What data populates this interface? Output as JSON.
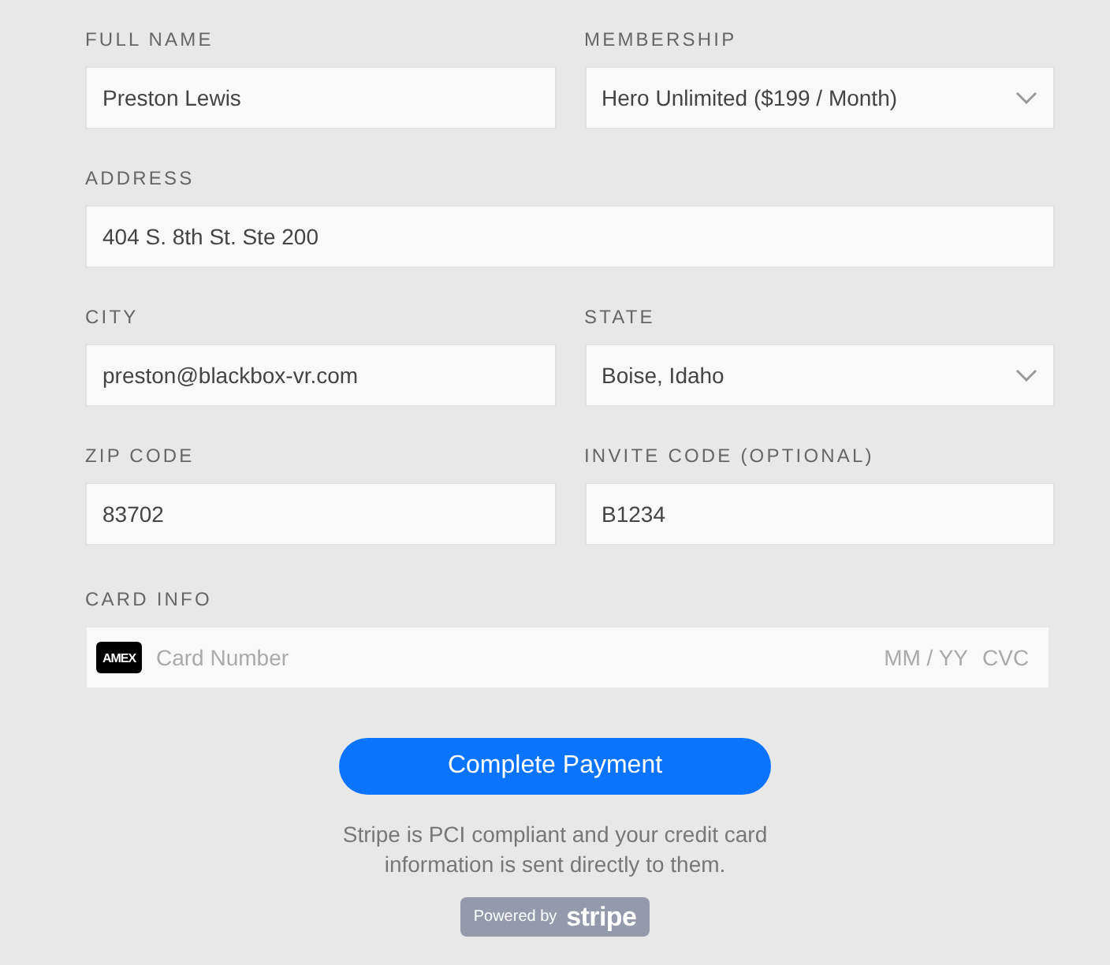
{
  "rows": [
    {
      "fields": [
        {
          "label": "FULL NAME",
          "kind": "text",
          "value": "Preston Lewis"
        },
        {
          "label": "MEMBERSHIP",
          "kind": "select",
          "value": "Hero Unlimited ($199 / Month)"
        }
      ]
    },
    {
      "fields": [
        {
          "label": "ADDRESS",
          "kind": "text",
          "value": "404 S. 8th St. Ste 200"
        }
      ]
    },
    {
      "fields": [
        {
          "label": "CITY",
          "kind": "text",
          "value": "preston@blackbox-vr.com"
        },
        {
          "label": "STATE",
          "kind": "select",
          "value": "Boise, Idaho"
        }
      ]
    },
    {
      "fields": [
        {
          "label": "ZIP CODE",
          "kind": "text",
          "value": "83702"
        },
        {
          "label": "INVITE CODE (OPTIONAL)",
          "kind": "text",
          "value": "B1234"
        }
      ]
    }
  ],
  "card": {
    "label": "CARD INFO",
    "brand": "AMEX",
    "number_placeholder": "Card Number",
    "expiry_placeholder": "MM / YY",
    "cvc_placeholder": "CVC"
  },
  "submit": {
    "label": "Complete Payment"
  },
  "note": "Stripe is PCI compliant and your credit card information is sent directly to them.",
  "badge": {
    "prefix": "Powered by",
    "brand": "stripe"
  }
}
